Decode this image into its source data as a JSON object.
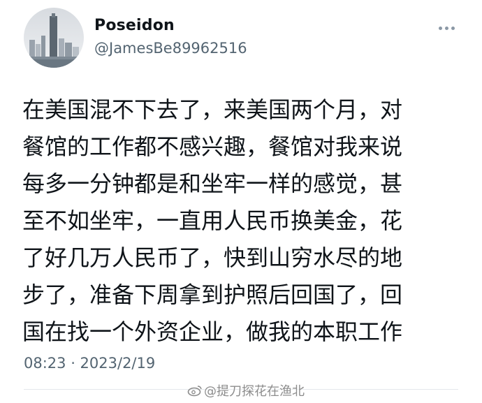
{
  "user": {
    "display_name": "Poseidon",
    "handle": "@JamesBe89962516"
  },
  "tweet": {
    "lines": [
      "在美国混不下去了，来美国两个月，对",
      "餐馆的工作都不感兴趣，餐馆对我来说",
      "每多一分钟都是和坐牢一样的感觉，甚",
      "至不如坐牢，一直用人民币换美金，花",
      "了好几万人民币了，快到山穷水尽的地",
      "步了，准备下周拿到护照后回国了，回",
      "国在找一个外资企业，做我的本职工作"
    ]
  },
  "meta": {
    "timestamp": "08:23 · 2023/2/19"
  },
  "watermark": {
    "text": "@提刀探花在渔北"
  },
  "icons": {
    "more": "more-horizontal-icon",
    "watermark_logo": "weibo-logo-icon"
  },
  "colors": {
    "text_primary": "#0f1419",
    "text_secondary": "#536471",
    "divider": "#e4e8eb"
  }
}
